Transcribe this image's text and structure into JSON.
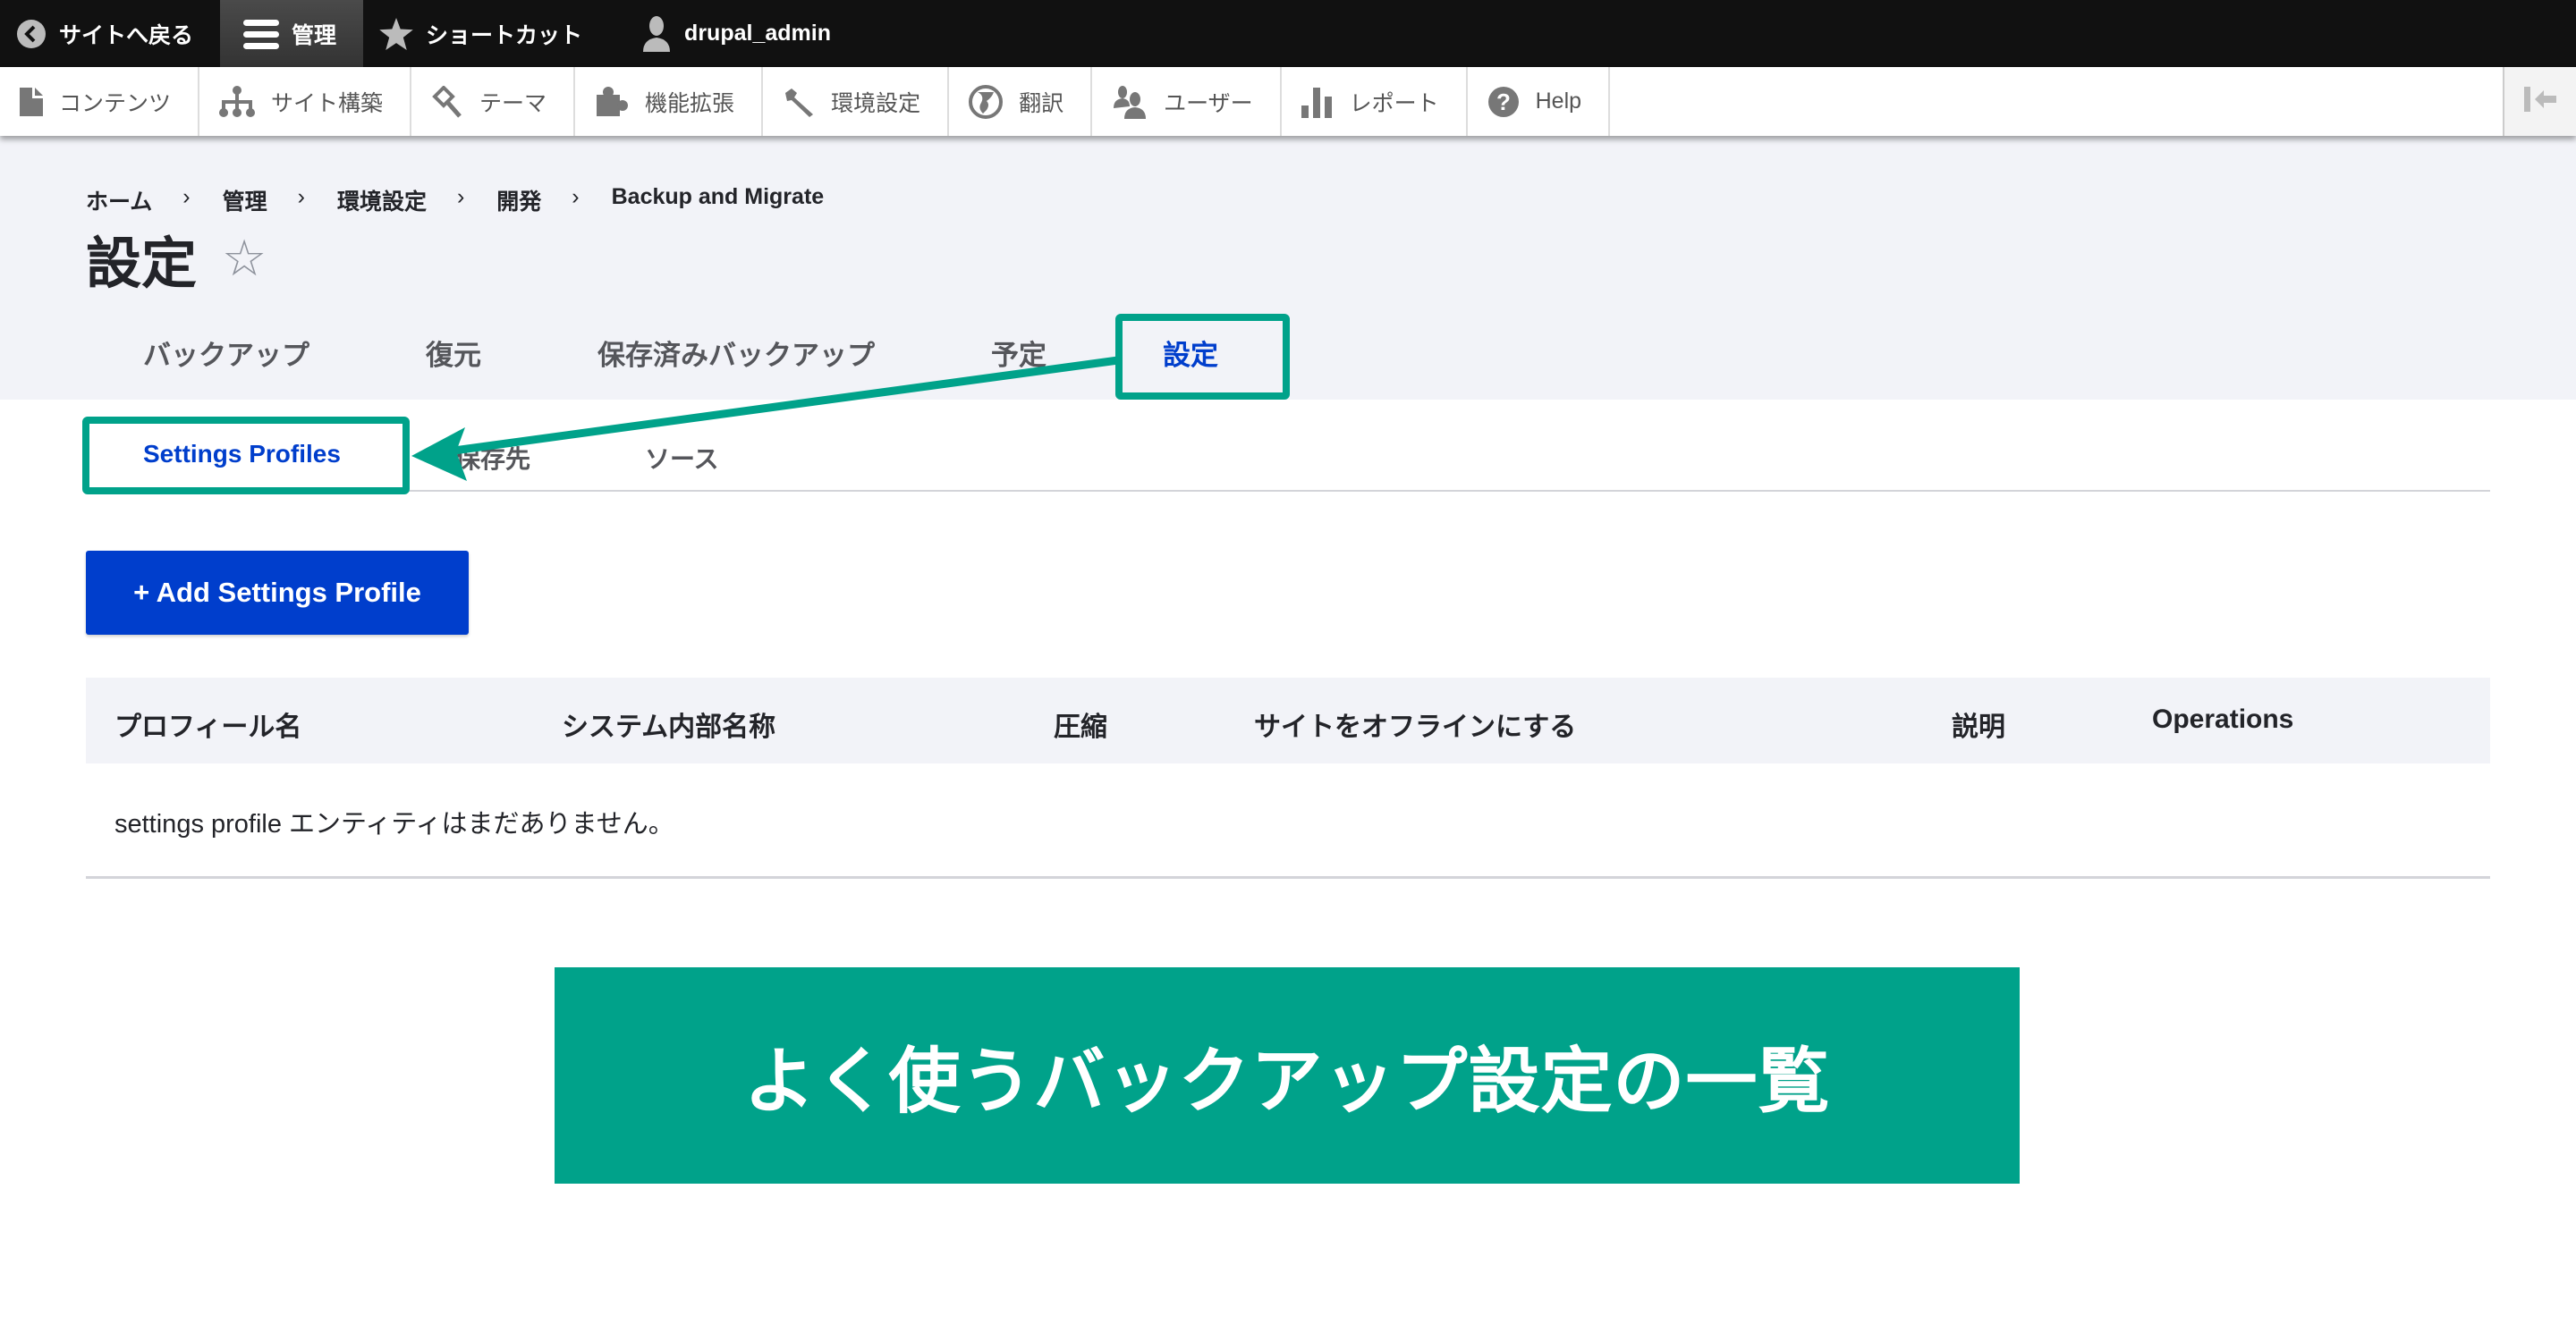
{
  "toolbar": {
    "items": [
      {
        "label": "サイトへ戻る",
        "icon": "back-circle-icon"
      },
      {
        "label": "管理",
        "icon": "hamburger-menu-icon",
        "active": true
      },
      {
        "label": "ショートカット",
        "icon": "star-icon"
      },
      {
        "label": "drupal_admin",
        "icon": "user-icon"
      }
    ]
  },
  "tray": {
    "items": [
      {
        "label": "コンテンツ",
        "icon": "document-icon"
      },
      {
        "label": "サイト構築",
        "icon": "sitemap-icon"
      },
      {
        "label": "テーマ",
        "icon": "paint-brush-icon"
      },
      {
        "label": "機能拡張",
        "icon": "puzzle-icon"
      },
      {
        "label": "環境設定",
        "icon": "wrench-icon"
      },
      {
        "label": "翻訳",
        "icon": "globe-icon"
      },
      {
        "label": "ユーザー",
        "icon": "people-icon"
      },
      {
        "label": "レポート",
        "icon": "bar-chart-icon"
      },
      {
        "label": "Help",
        "icon": "help-icon"
      }
    ],
    "toggle_icon": "collapse-tray-icon"
  },
  "breadcrumb": [
    "ホーム",
    "管理",
    "環境設定",
    "開発",
    "Backup and Migrate"
  ],
  "breadcrumb_separator": "›",
  "page": {
    "title": "設定",
    "star": "☆"
  },
  "tabs": [
    {
      "label": "バックアップ"
    },
    {
      "label": "復元"
    },
    {
      "label": "保存済みバックアップ"
    },
    {
      "label": "予定"
    },
    {
      "label": "設定",
      "active": true
    }
  ],
  "subtabs": [
    {
      "label": "Settings Profiles",
      "active": true
    },
    {
      "label": "保存先"
    },
    {
      "label": "ソース"
    }
  ],
  "add_button": "+ Add Settings Profile",
  "table": {
    "headers": [
      "プロフィール名",
      "システム内部名称",
      "圧縮",
      "サイトをオフラインにする",
      "説明",
      "Operations"
    ],
    "empty_message": "settings profile エンティティはまだありません。"
  },
  "banner": {
    "text": "よく使うバックアップ設定の一覧"
  },
  "colors": {
    "accent": "#00a28a",
    "primary": "#003ecc",
    "toolbar": "#111111",
    "header_bg": "#f2f3f8"
  }
}
